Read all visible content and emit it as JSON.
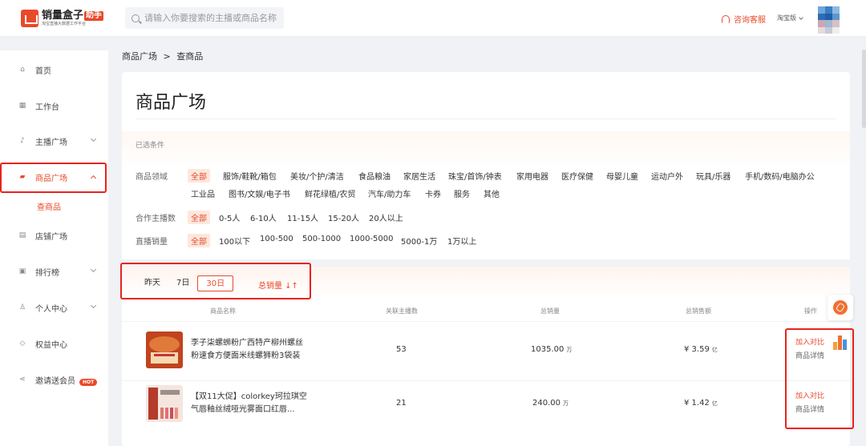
{
  "header": {
    "logo_title": "销量盒子",
    "logo_badge": "助手",
    "logo_sub": "淘宝直播大数据工作平台",
    "search_placeholder": "请输入你要搜索的主播或商品名称",
    "customer_service": "咨询客服",
    "version": "淘宝版"
  },
  "sidebar": {
    "items": [
      {
        "label": "首页",
        "icon": "home-icon"
      },
      {
        "label": "工作台",
        "icon": "grid-icon"
      },
      {
        "label": "主播广场",
        "icon": "mic-icon"
      },
      {
        "label": "商品广场",
        "icon": "bag-icon"
      },
      {
        "label": "店铺广场",
        "icon": "store-icon"
      },
      {
        "label": "排行榜",
        "icon": "rank-icon"
      },
      {
        "label": "个人中心",
        "icon": "user-icon"
      },
      {
        "label": "权益中心",
        "icon": "benefit-icon"
      },
      {
        "label": "邀请送会员",
        "icon": "share-icon"
      }
    ],
    "sub_item": "查商品",
    "hot_badge": "HOT"
  },
  "breadcrumb": {
    "parent": "商品广场",
    "sep": ">",
    "current": "查商品"
  },
  "page_title": "商品广场",
  "filters": {
    "selected_label": "已选条件",
    "category": {
      "label": "商品领域",
      "options": [
        "全部",
        "服饰/鞋靴/箱包",
        "美妆/个护/清洁",
        "食品粮油",
        "家居生活",
        "珠宝/首饰/钟表",
        "家用电器",
        "医疗保健",
        "母婴儿童",
        "运动户外",
        "玩具/乐器",
        "手机/数码/电脑办公",
        "工业品",
        "图书/文娱/电子书",
        "鲜花绿植/农贸",
        "汽车/助力车",
        "卡券",
        "服务",
        "其他"
      ]
    },
    "streamers": {
      "label": "合作主播数",
      "options": [
        "全部",
        "0-5人",
        "6-10人",
        "11-15人",
        "15-20人",
        "20人以上"
      ]
    },
    "sales": {
      "label": "直播销量",
      "options": [
        "全部",
        "100以下",
        "100-500",
        "500-1000",
        "1000-5000",
        "5000-1万",
        "1万以上"
      ]
    }
  },
  "toolbar": {
    "periods": [
      "昨天",
      "7日",
      "30日"
    ],
    "active_period": "30日",
    "sort_label": "总销量 ↓↑"
  },
  "table": {
    "headers": [
      "商品名称",
      "关联主播数",
      "总销量",
      "总销售额",
      "操作"
    ],
    "rows": [
      {
        "name": "李子柒螺蛳粉广西特产柳州螺丝粉速食方便面米线螺狮粉3袋装",
        "anchors": "53",
        "sales": "1035.00",
        "sales_unit": "万",
        "revenue": "¥ 3.59",
        "revenue_unit": "亿",
        "add": "加入对比",
        "detail": "商品详情"
      },
      {
        "name": "【双11大促】colorkey珂拉琪空气唇釉丝绒哑光雾面口红唇...",
        "anchors": "21",
        "sales": "240.00",
        "sales_unit": "万",
        "revenue": "¥ 1.42",
        "revenue_unit": "亿",
        "add": "加入对比",
        "detail": "商品详情"
      }
    ]
  },
  "colors": {
    "accent": "#e8492b",
    "highlight_box": "#e8231b"
  }
}
